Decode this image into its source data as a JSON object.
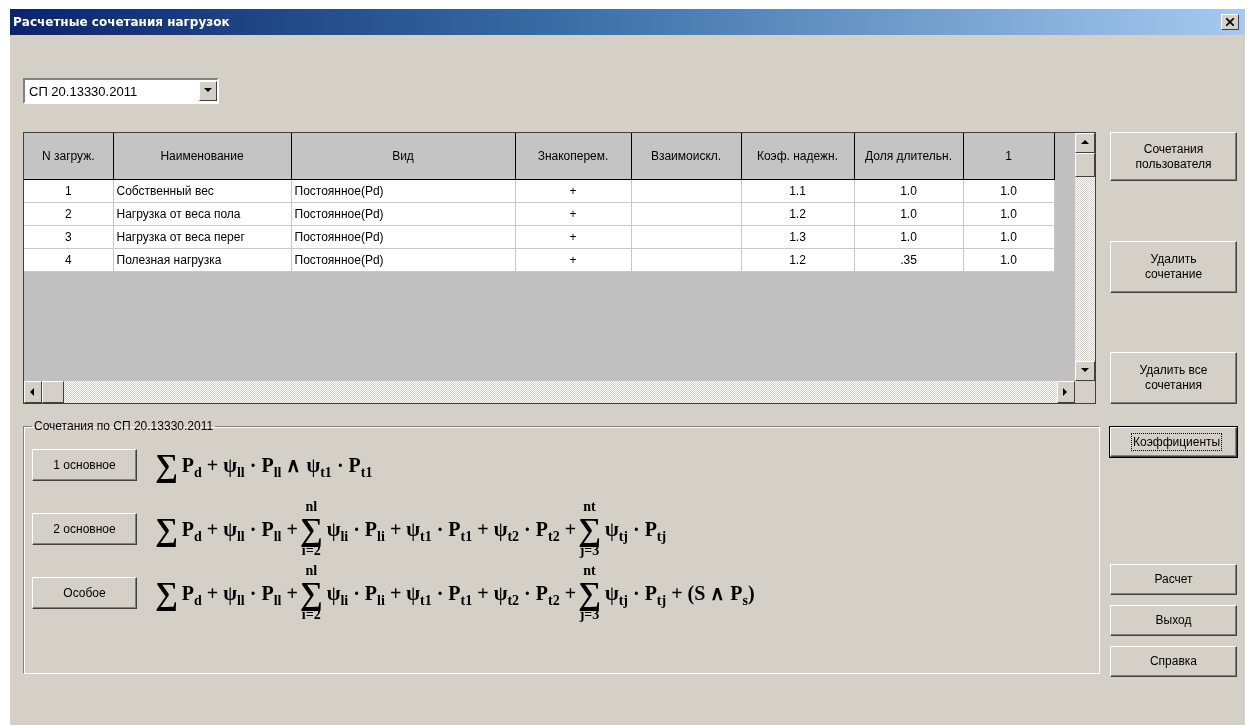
{
  "window": {
    "title": "Расчетные сочетания нагрузок"
  },
  "norm_select": {
    "value": "СП 20.13330.2011"
  },
  "table": {
    "columns": [
      "N загруж.",
      "Наименование",
      "Вид",
      "Знакоперем.",
      "Взаимоискл.",
      "Коэф. надежн.",
      "Доля длительн.",
      "1"
    ],
    "rows": [
      [
        "1",
        "Собственный вес",
        "Постоянное(Pd)",
        "+",
        "",
        "1.1",
        "1.0",
        "1.0"
      ],
      [
        "2",
        "Нагрузка от веса пола",
        "Постоянное(Pd)",
        "+",
        "",
        "1.2",
        "1.0",
        "1.0"
      ],
      [
        "3",
        "Нагрузка от  веса перег",
        "Постоянное(Pd)",
        "+",
        "",
        "1.3",
        "1.0",
        "1.0"
      ],
      [
        "4",
        "Полезная нагрузка",
        "Постоянное(Pd)",
        "+",
        "",
        "1.2",
        ".35",
        "1.0"
      ]
    ]
  },
  "top_buttons": [
    {
      "label": "Сочетания пользователя"
    },
    {
      "label": "Удалить сочетание"
    },
    {
      "label": "Удалить все сочетания"
    }
  ],
  "coefficients_button": {
    "label": "Коэффициенты",
    "focused": true
  },
  "bottom_buttons": [
    {
      "label": "Расчет"
    },
    {
      "label": "Выход"
    },
    {
      "label": "Справка"
    }
  ],
  "combinations": {
    "legend": "Сочетания по СП 20.13330.2011",
    "rows": [
      {
        "button": "1 основное",
        "formula": [
          {
            "kind": "sum",
            "symbol": "∑"
          },
          {
            "kind": "text",
            "text": "P$_{d}$ + ψ$_{ll}$ · P$_{ll}$ ∧ ψ$_{t1}$ · P$_{t1}$"
          }
        ]
      },
      {
        "button": "2 основное",
        "formula": [
          {
            "kind": "sum",
            "symbol": "∑"
          },
          {
            "kind": "text",
            "text": "P$_{d}$ + ψ$_{ll}$ · P$_{ll}$ +"
          },
          {
            "kind": "sum",
            "symbol": "∑",
            "upper": "nl",
            "lower": "i=2"
          },
          {
            "kind": "text",
            "text": "ψ$_{li}$ · P$_{li}$ + ψ$_{t1}$ · P$_{t1}$ + ψ$_{t2}$ · P$_{t2}$ +"
          },
          {
            "kind": "sum",
            "symbol": "∑",
            "upper": "nt",
            "lower": "j=3"
          },
          {
            "kind": "text",
            "text": "ψ$_{tj}$ · P$_{tj}$"
          }
        ]
      },
      {
        "button": "Особое",
        "formula": [
          {
            "kind": "sum",
            "symbol": "∑"
          },
          {
            "kind": "text",
            "text": "P$_{d}$ + ψ$_{ll}$ · P$_{ll}$ +"
          },
          {
            "kind": "sum",
            "symbol": "∑",
            "upper": "nl",
            "lower": "i=2"
          },
          {
            "kind": "text",
            "text": "ψ$_{li}$ · P$_{li}$ + ψ$_{t1}$ · P$_{t1}$ + ψ$_{t2}$ · P$_{t2}$ +"
          },
          {
            "kind": "sum",
            "symbol": "∑",
            "upper": "nt",
            "lower": "j=3"
          },
          {
            "kind": "text",
            "text": "ψ$_{tj}$ · P$_{tj}$ + (S ∧ P$_{s}$)"
          }
        ]
      }
    ]
  }
}
